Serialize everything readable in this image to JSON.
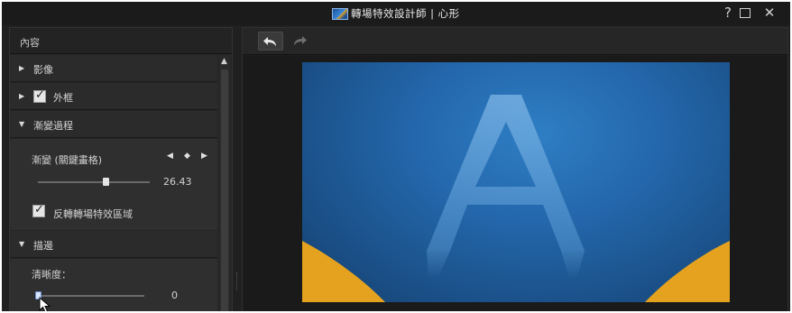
{
  "window": {
    "title": "轉場特效設計師 | 心形",
    "help_label": "?",
    "close_label": "✕"
  },
  "left_panel": {
    "header": "內容",
    "sections": {
      "image": {
        "label": "影像",
        "expanded": false
      },
      "frame": {
        "label": "外框",
        "expanded": false,
        "checked": true
      },
      "transition": {
        "label": "漸變過程",
        "expanded": true,
        "keyframe_label": "漸變 (關鍵畫格)",
        "value": "26.43",
        "invert_label": "反轉轉場特效區域",
        "invert_checked": true
      },
      "edge": {
        "label": "描邊",
        "expanded": true,
        "sharpness_label": "清晰度：",
        "sharpness_value": "0"
      }
    }
  },
  "toolbar": {
    "undo_icon": "undo-arrow",
    "redo_icon": "redo-arrow"
  },
  "preview": {
    "letter": "A",
    "background_color": "#2468ad",
    "shape_color": "#e5a21f"
  }
}
